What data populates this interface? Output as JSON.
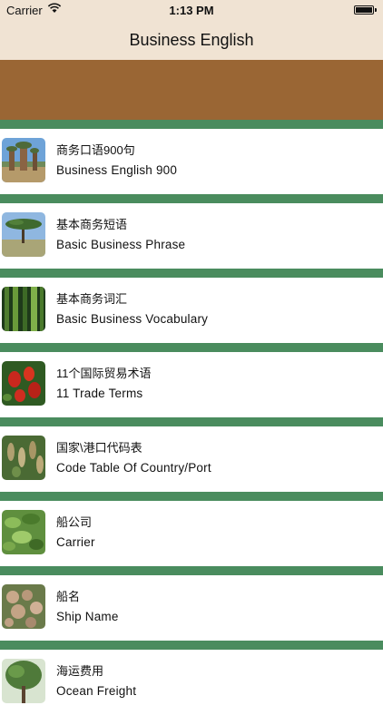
{
  "status_bar": {
    "carrier": "Carrier",
    "time": "1:13 PM"
  },
  "nav": {
    "title": "Business English"
  },
  "colors": {
    "nav_bg": "#f0e3d3",
    "banner": "#9a6634",
    "separator": "#4a8c5e"
  },
  "items": [
    {
      "zh": "商务口语900句",
      "en": "Business English 900",
      "thumb": "baobab-photo"
    },
    {
      "zh": "基本商务短语",
      "en": "Basic Business Phrase",
      "thumb": "acacia-tree-photo"
    },
    {
      "zh": "基本商务词汇",
      "en": "Basic Business Vocabulary",
      "thumb": "bamboo-photo"
    },
    {
      "zh": "11个国际贸易术语",
      "en": "11 Trade Terms",
      "thumb": "red-fruit-photo"
    },
    {
      "zh": "国家\\港口代码表",
      "en": "Code Table Of Country/Port",
      "thumb": "hanging-fruit-photo"
    },
    {
      "zh": "船公司",
      "en": "Carrier",
      "thumb": "leaves-photo"
    },
    {
      "zh": "船名",
      "en": "Ship Name",
      "thumb": "nuts-photo"
    },
    {
      "zh": "海运费用",
      "en": "Ocean Freight",
      "thumb": "tree-photo"
    }
  ]
}
